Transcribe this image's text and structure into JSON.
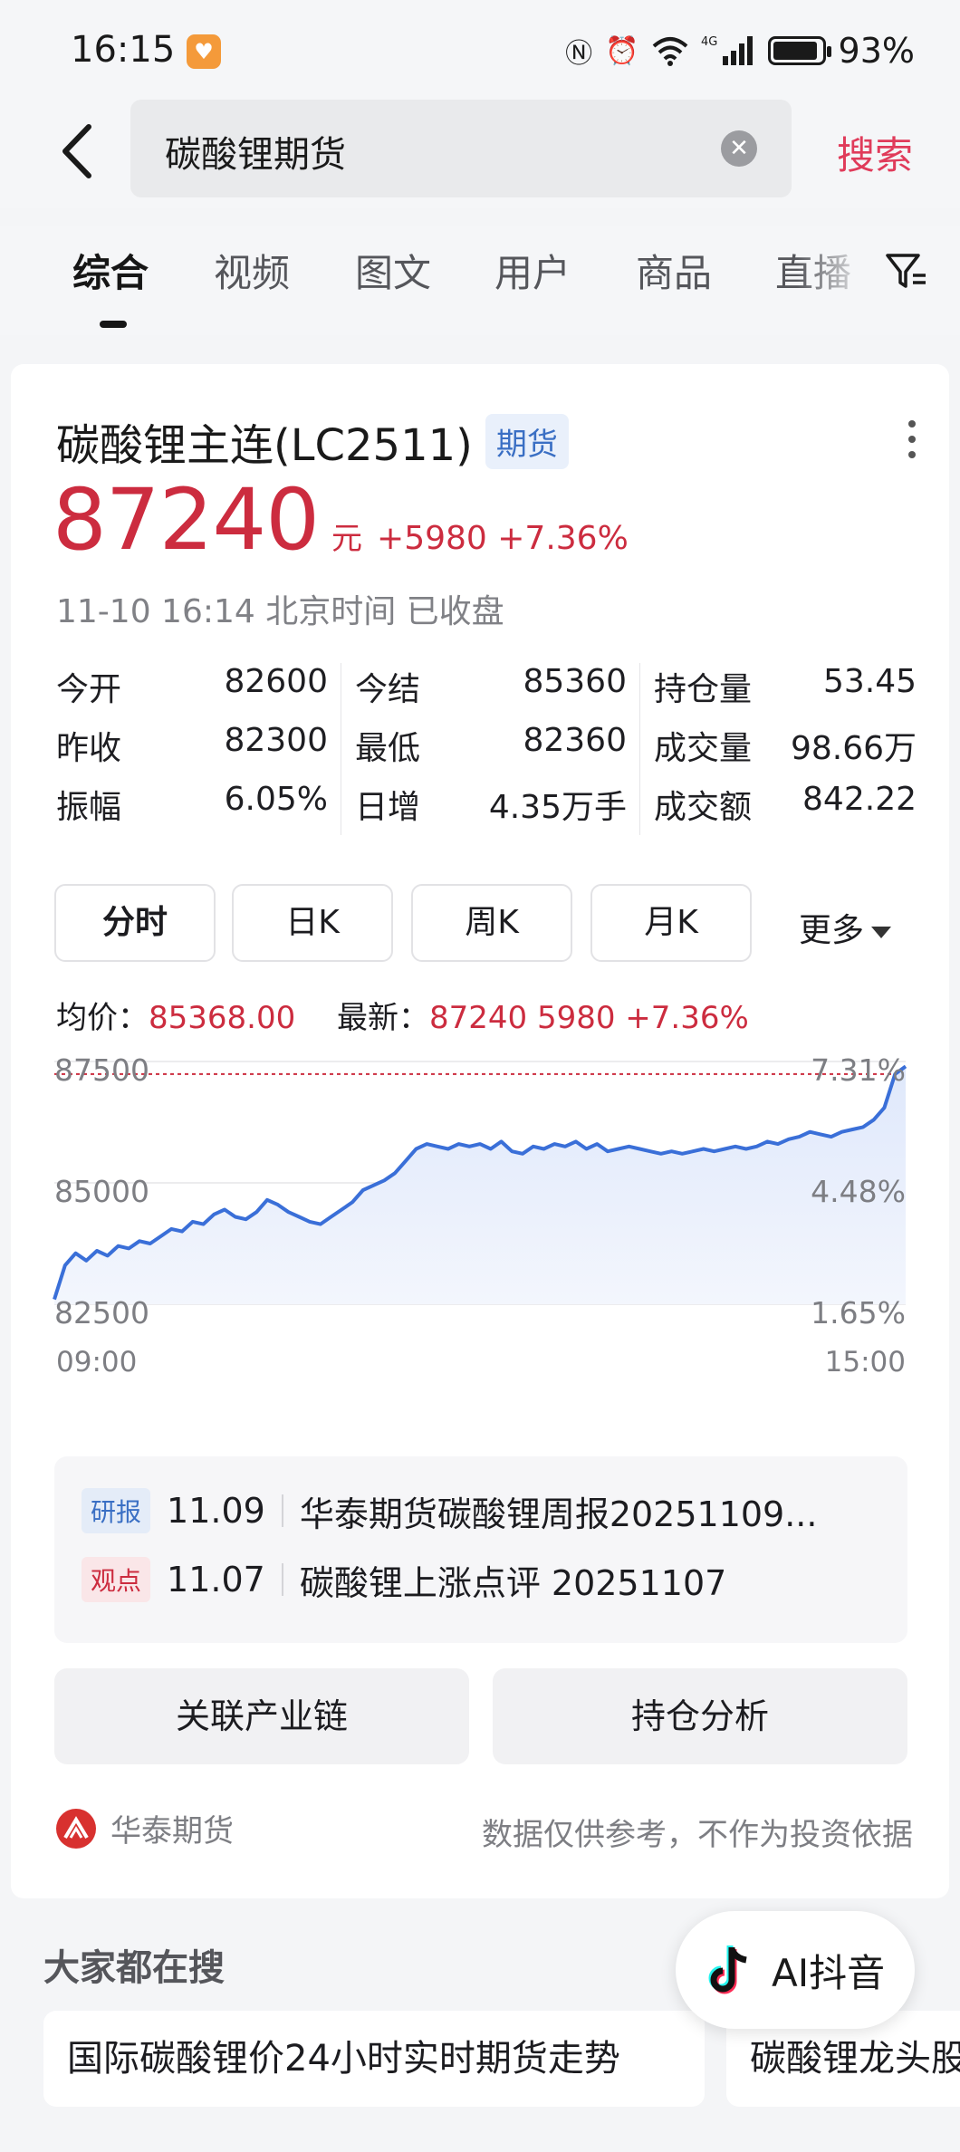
{
  "status_bar": {
    "time": "16:15",
    "battery": "93%",
    "network": "4G"
  },
  "search": {
    "query": "碳酸锂期货",
    "submit_label": "搜索"
  },
  "tabs": [
    {
      "label": "综合",
      "active": true
    },
    {
      "label": "视频"
    },
    {
      "label": "图文"
    },
    {
      "label": "用户"
    },
    {
      "label": "商品"
    },
    {
      "label": "直播"
    }
  ],
  "instrument": {
    "title": "碳酸锂主连(LC2511)",
    "type_badge": "期货",
    "price": "87240",
    "unit": "元",
    "change": "+5980 +7.36%",
    "timestamp": "11-10 16:14 北京时间 已收盘"
  },
  "stats": {
    "col1": [
      {
        "label": "今开",
        "value": "82600",
        "color": "#cc2c3f"
      },
      {
        "label": "昨收",
        "value": "82300"
      },
      {
        "label": "振幅",
        "value": "6.05%"
      }
    ],
    "col2": [
      {
        "label": "今结",
        "value": "85360",
        "color": "#cc2c3f"
      },
      {
        "label": "最低",
        "value": "82360",
        "color": "#cc2c3f"
      },
      {
        "label": "日增",
        "value": "4.35万手"
      }
    ],
    "col3": [
      {
        "label": "持仓量",
        "value": "53.45"
      },
      {
        "label": "成交量",
        "value": "98.66万"
      },
      {
        "label": "成交额",
        "value": "842.22"
      }
    ]
  },
  "period_tabs": {
    "items": [
      "分时",
      "日K",
      "周K",
      "月K"
    ],
    "more": "更多"
  },
  "summary": {
    "avg_label": "均价：",
    "avg_value": "85368.00",
    "latest_label": "最新：",
    "latest_value": "87240 5980 +7.36%"
  },
  "chart_data": {
    "type": "line",
    "title": "",
    "xlabel": "",
    "ylabel": "",
    "x_ticks": [
      "09:00",
      "15:00"
    ],
    "y_ticks_left": [
      "87500",
      "85000",
      "82500"
    ],
    "y_ticks_right": [
      "7.31%",
      "4.48%",
      "1.65%"
    ],
    "ylim": [
      82500,
      87500
    ],
    "reference_line": 87240,
    "grid": true,
    "series": [
      {
        "values": [
          82600,
          83300,
          83550,
          83400,
          83600,
          83500,
          83700,
          83650,
          83800,
          83750,
          83900,
          84050,
          84000,
          84200,
          84150,
          84350,
          84450,
          84300,
          84250,
          84400,
          84650,
          84550,
          84400,
          84300,
          84200,
          84150,
          84300,
          84450,
          84600,
          84850,
          84950,
          85050,
          85200,
          85450,
          85700,
          85800,
          85750,
          85700,
          85800,
          85750,
          85800,
          85700,
          85850,
          85650,
          85600,
          85750,
          85700,
          85800,
          85750,
          85850,
          85700,
          85800,
          85650,
          85700,
          85750,
          85700,
          85650,
          85600,
          85650,
          85600,
          85650,
          85700,
          85650,
          85700,
          85750,
          85700,
          85750,
          85850,
          85800,
          85900,
          85950,
          86050,
          86000,
          85950,
          86050,
          86100,
          86150,
          86300,
          86550,
          87240,
          87400
        ]
      }
    ]
  },
  "news": [
    {
      "tag": "研报",
      "date": "11.09",
      "title": "华泰期货碳酸锂周报20251109..."
    },
    {
      "tag": "观点",
      "date": "11.07",
      "title": "碳酸锂上涨点评 20251107"
    }
  ],
  "actions": {
    "industry_chain": "关联产业链",
    "position_analysis": "持仓分析"
  },
  "source": {
    "name": "华泰期货",
    "disclaimer": "数据仅供参考，不作为投资依据"
  },
  "trending": {
    "heading": "大家都在搜",
    "items": [
      "国际碳酸锂价24小时实时期货走势",
      "碳酸锂龙头股"
    ]
  },
  "ai_pill": {
    "label": "AI抖音"
  },
  "colors": {
    "up_red": "#cc2c3f",
    "search_accent": "#e03b5a",
    "chart_line": "#3a6fd8",
    "badge_blue": "#3a6fc4"
  }
}
